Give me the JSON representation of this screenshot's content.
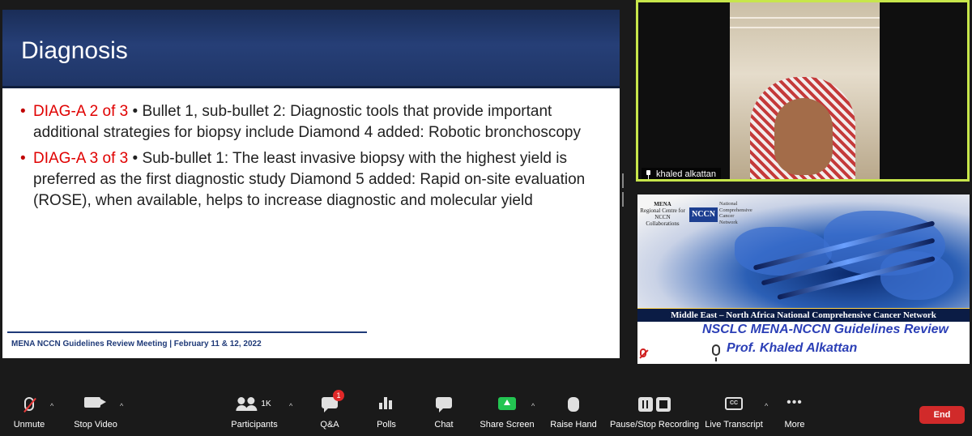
{
  "slide": {
    "title": "Diagnosis",
    "bullets": [
      {
        "tag": "DIAG-A 2 of 3",
        "text": " • Bullet 1, sub-bullet 2: Diagnostic tools that provide important additional strategies for biopsy include Diamond 4 added: Robotic bronchoscopy"
      },
      {
        "tag": " DIAG-A 3 of 3",
        "text": " • Sub-bullet 1: The least invasive biopsy with the highest yield is preferred as the first diagnostic study Diamond 5 added: Rapid on-site evaluation (ROSE), when available, helps to increase diagnostic and molecular yield"
      }
    ],
    "footer": "MENA NCCN Guidelines Review Meeting | February 11 & 12, 2022"
  },
  "video": {
    "participant_name": "khaled alkattan",
    "border_color": "#c7e64b"
  },
  "banner": {
    "org_left_line1": "MENA",
    "org_left_line2": "Regional Centre for",
    "org_left_line3": "NCCN Collaborations",
    "logo": "NCCN",
    "org_right_line1": "National",
    "org_right_line2": "Comprehensive",
    "org_right_line3": "Cancer",
    "org_right_line4": "Network",
    "network_band": "Middle East – North Africa National Comprehensive Cancer Network",
    "review_title": "NSCLC MENA-NCCN Guidelines Review",
    "presenter": "Prof. Khaled Alkattan"
  },
  "toolbar": {
    "unmute": "Unmute",
    "stop_video": "Stop Video",
    "participants_count": "1K",
    "participants": "Participants",
    "qa": "Q&A",
    "qa_badge": "1",
    "polls": "Polls",
    "chat": "Chat",
    "share_screen": "Share Screen",
    "raise_hand": "Raise Hand",
    "recording": "Pause/Stop Recording",
    "live_transcript": "Live Transcript",
    "cc": "CC",
    "more": "More",
    "end": "End"
  },
  "colors": {
    "end": "#d12a2a",
    "share": "#23c552",
    "slide_header": "#263f77",
    "bullet_tag": "#e00000"
  }
}
